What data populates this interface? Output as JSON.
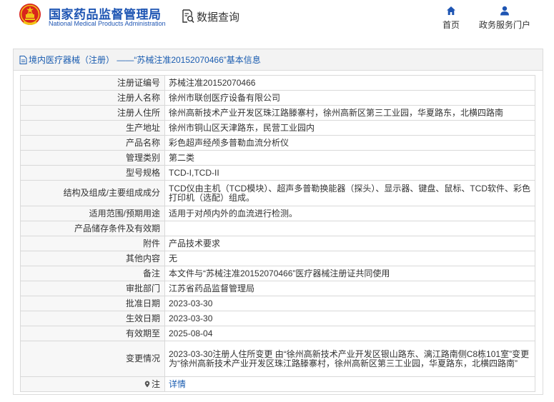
{
  "header": {
    "brand_cn": "国家药品监督管理局",
    "brand_en": "National Medical Products Administration",
    "query_label": "数据查询",
    "nav": [
      {
        "label": "首页",
        "icon": "home-icon"
      },
      {
        "label": "政务服务门户",
        "icon": "user-icon"
      }
    ]
  },
  "panel": {
    "title": "境内医疗器械（注册） ——“苏械注准20152070466”基本信息",
    "rows": [
      {
        "label": "注册证编号",
        "value": "苏械注准20152070466"
      },
      {
        "label": "注册人名称",
        "value": "徐州市联创医疗设备有限公司"
      },
      {
        "label": "注册人住所",
        "value": "徐州高新技术产业开发区珠江路滕寨村，徐州高新区第三工业园，华夏路东，北横四路南"
      },
      {
        "label": "生产地址",
        "value": "徐州市铜山区天津路东，民营工业园内"
      },
      {
        "label": "产品名称",
        "value": "彩色超声经颅多普勒血流分析仪"
      },
      {
        "label": "管理类别",
        "value": "第二类"
      },
      {
        "label": "型号规格",
        "value": "TCD-I,TCD-II"
      },
      {
        "label": "结构及组成/主要组成成分",
        "value": "TCD仪由主机（TCD模块）、超声多普勒换能器（探头）、显示器、键盘、鼠标、TCD软件、彩色打印机（选配）组成。"
      },
      {
        "label": "适用范围/预期用途",
        "value": "适用于对颅内外的血流进行检测。"
      },
      {
        "label": "产品储存条件及有效期",
        "value": ""
      },
      {
        "label": "附件",
        "value": "产品技术要求"
      },
      {
        "label": "其他内容",
        "value": "无"
      },
      {
        "label": "备注",
        "value": "本文件与“苏械注准20152070466”医疗器械注册证共同使用"
      },
      {
        "label": "审批部门",
        "value": "江苏省药品监督管理局"
      },
      {
        "label": "批准日期",
        "value": "2023-03-30"
      },
      {
        "label": "生效日期",
        "value": "2023-03-30"
      },
      {
        "label": "有效期至",
        "value": "2025-08-04"
      },
      {
        "label": "变更情况",
        "value": "2023-03-30注册人住所变更 由“徐州高新技术产业开发区银山路东、漓江路南侧C8栋101室”变更为“徐州高新技术产业开发区珠江路滕寨村，徐州高新区第三工业园，华夏路东，北横四路南”"
      },
      {
        "label": "注",
        "value": "详情"
      }
    ]
  },
  "colors": {
    "brand_blue": "#1e55b3",
    "link_blue": "#1a5cb0",
    "emblem_red": "#d9251c",
    "emblem_gold": "#f2c418"
  }
}
